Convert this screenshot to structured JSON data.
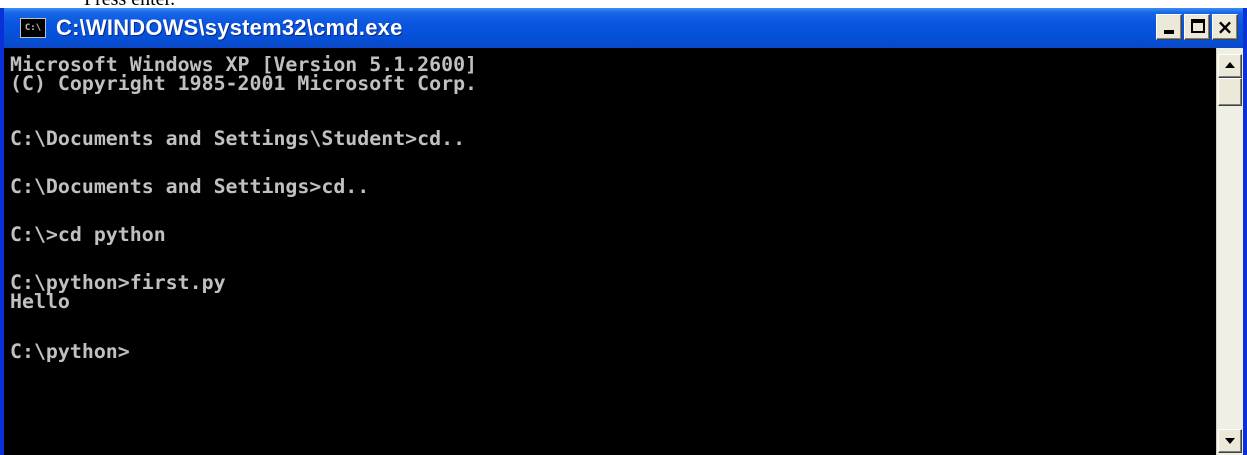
{
  "document": {
    "fragment_text": "Press enter."
  },
  "window": {
    "title": "C:\\WINDOWS\\system32\\cmd.exe",
    "icon": "cmd-console-icon",
    "icon_text": "C:\\",
    "buttons": {
      "minimize": "minimize-icon",
      "maximize": "maximize-icon",
      "close_glyph": "×"
    }
  },
  "console": {
    "colors": {
      "background": "#000000",
      "foreground": "#c0c0c0",
      "titlebar": "#0a55e0"
    },
    "lines": [
      "Microsoft Windows XP [Version 5.1.2600]",
      "(C) Copyright 1985-2001 Microsoft Corp.",
      "",
      "C:\\Documents and Settings\\Student>cd..",
      "",
      "C:\\Documents and Settings>cd..",
      "",
      "C:\\>cd python",
      "",
      "C:\\python>first.py",
      "Hello",
      "",
      "C:\\python>"
    ]
  },
  "scrollbar": {
    "up_icon": "scroll-up-arrow-icon",
    "down_icon": "scroll-down-arrow-icon"
  }
}
